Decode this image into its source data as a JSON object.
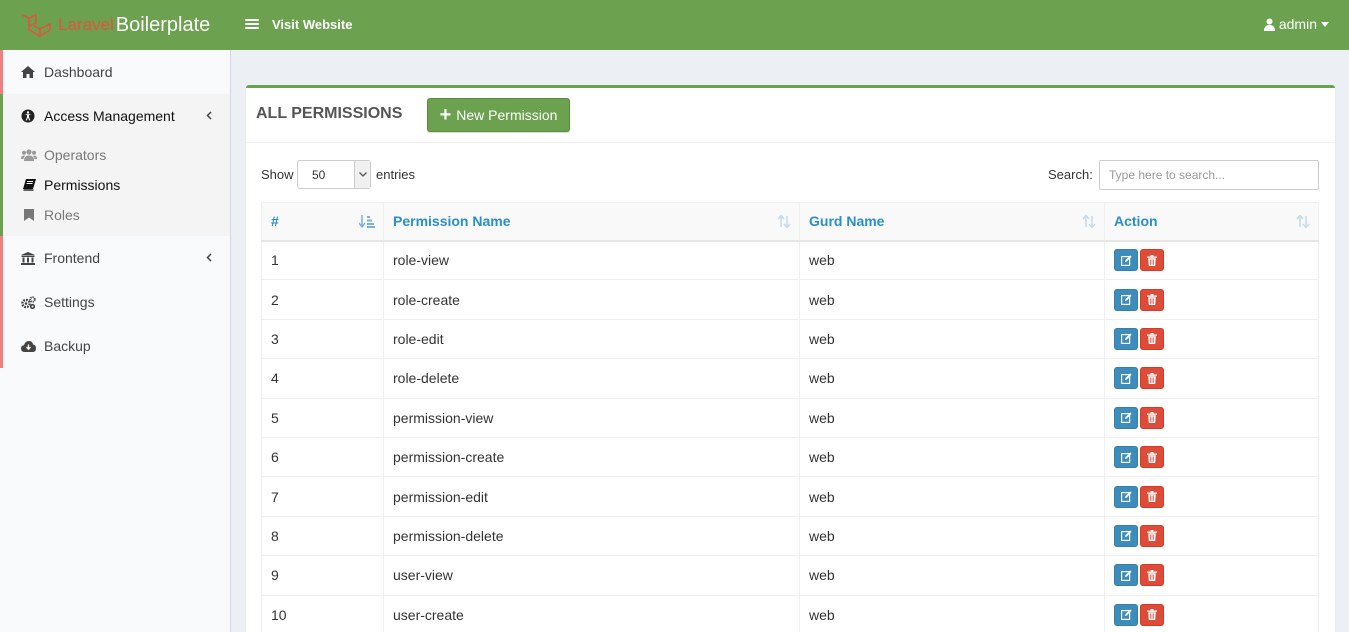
{
  "app": {
    "brand_part1": "Laravel",
    "brand_part2": "Boilerplate",
    "visit_website": "Visit Website",
    "user": "admin"
  },
  "sidebar": {
    "items": [
      {
        "label": "Dashboard",
        "icon": "home-icon"
      },
      {
        "label": "Access Management",
        "icon": "universal-access-icon"
      },
      {
        "label": "Frontend",
        "icon": "bank-icon"
      },
      {
        "label": "Settings",
        "icon": "cogs-icon"
      },
      {
        "label": "Backup",
        "icon": "cloud-download-icon"
      }
    ],
    "submenu": [
      {
        "label": "Operators",
        "icon": "users-icon"
      },
      {
        "label": "Permissions",
        "icon": "book-icon"
      },
      {
        "label": "Roles",
        "icon": "bookmark-icon"
      }
    ]
  },
  "page": {
    "title": "ALL PERMISSIONS",
    "new_button": "New Permission",
    "show_label": "Show",
    "entries_value": "50",
    "entries_label": "entries",
    "search_label": "Search:",
    "search_placeholder": "Type here to search..."
  },
  "table": {
    "headers": [
      "#",
      "Permission Name",
      "Gurd Name",
      "Action"
    ],
    "rows": [
      {
        "id": "1",
        "name": "role-view",
        "guard": "web"
      },
      {
        "id": "2",
        "name": "role-create",
        "guard": "web"
      },
      {
        "id": "3",
        "name": "role-edit",
        "guard": "web"
      },
      {
        "id": "4",
        "name": "role-delete",
        "guard": "web"
      },
      {
        "id": "5",
        "name": "permission-view",
        "guard": "web"
      },
      {
        "id": "6",
        "name": "permission-create",
        "guard": "web"
      },
      {
        "id": "7",
        "name": "permission-edit",
        "guard": "web"
      },
      {
        "id": "8",
        "name": "permission-delete",
        "guard": "web"
      },
      {
        "id": "9",
        "name": "user-view",
        "guard": "web"
      },
      {
        "id": "10",
        "name": "user-create",
        "guard": "web"
      }
    ]
  },
  "colors": {
    "primary": "#6ba14f",
    "header_text": "#2a8fc7",
    "edit": "#3c8dbc",
    "delete": "#dd4b39"
  }
}
